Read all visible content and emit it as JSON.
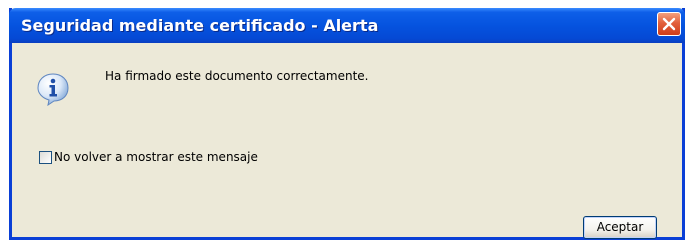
{
  "window": {
    "title": "Seguridad mediante certificado - Alerta",
    "close_icon": "close-icon"
  },
  "content": {
    "icon": "info-icon",
    "message": "Ha firmado este documento correctamente."
  },
  "options": {
    "dont_show_again_label": "No volver a mostrar este mensaje",
    "dont_show_again_checked": false
  },
  "buttons": {
    "ok_label": "Aceptar"
  },
  "colors": {
    "titlebar": "#0553df",
    "window_bg": "#ece9d8",
    "border": "#0a3fd6",
    "close_button": "#cf3d1a"
  }
}
